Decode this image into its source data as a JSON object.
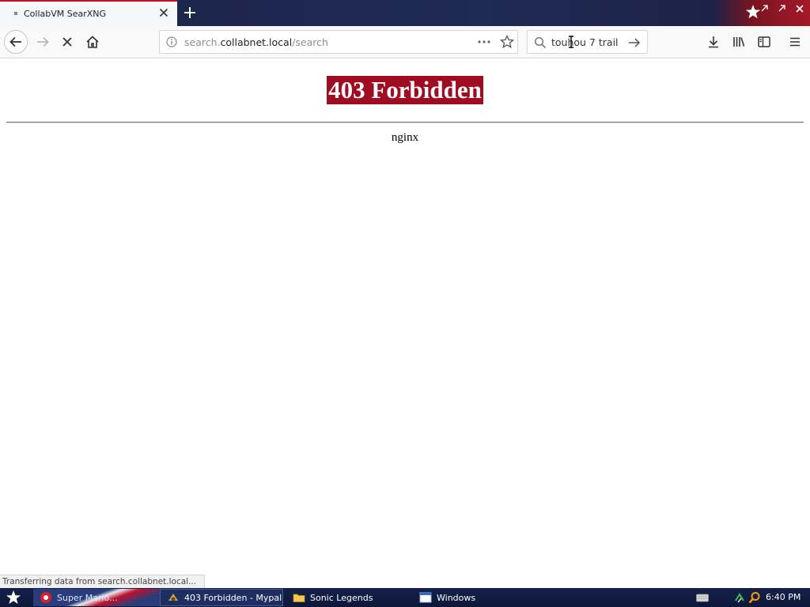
{
  "tab": {
    "title": "CollabVM SearXNG"
  },
  "toolbar": {
    "url_prefix": "search.",
    "url_host": "collabnet.local",
    "url_path": "/search",
    "search_query": "touhou 7 trail"
  },
  "page": {
    "heading": "403 Forbidden",
    "server": "nginx"
  },
  "status_text": "Transferring data from search.collabnet.local...",
  "taskbar": {
    "tasks": [
      {
        "label": "Super Mario..."
      },
      {
        "label": "403 Forbidden - Mypal"
      },
      {
        "label": "Sonic Legends"
      },
      {
        "label": "Windows"
      }
    ],
    "clock": "6:40 PM"
  },
  "colors": {
    "heading_bg": "#a00d22",
    "tab_accent": "#c0102a",
    "taskbar_bg": "#15214a"
  }
}
